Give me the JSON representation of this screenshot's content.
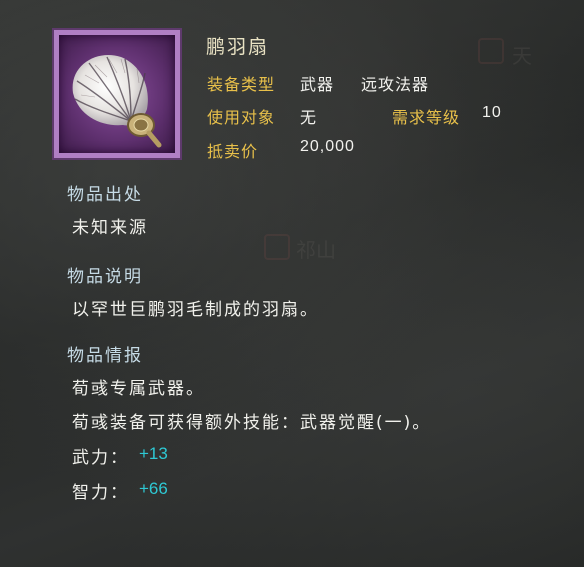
{
  "item": {
    "name": "鹏羽扇",
    "equip_type_label": "装备类型",
    "equip_type_value": "武器",
    "equip_subtype": "远攻法器",
    "target_label": "使用对象",
    "target_value": "无",
    "level_label": "需求等级",
    "level_value": "10",
    "price_label": "抵卖价",
    "price_value": "20,000"
  },
  "origin": {
    "heading": "物品出处",
    "text": "未知来源"
  },
  "description": {
    "heading": "物品说明",
    "text": "以罕世巨鹏羽毛制成的羽扇。"
  },
  "info": {
    "heading": "物品情报",
    "line1": "荀彧专属武器。",
    "line2": "荀彧装备可获得额外技能：武器觉醒(一)。",
    "stat1_label": "武力：",
    "stat1_value": "+13",
    "stat2_label": "智力：",
    "stat2_value": "+66"
  },
  "watermark": {
    "text1": "天",
    "text2": "祁山"
  },
  "colors": {
    "gold": "#e8c04a",
    "cyan": "#2ec9d4",
    "frame": "#b07fc4"
  },
  "icons": {
    "item": "feather-fan-icon"
  }
}
